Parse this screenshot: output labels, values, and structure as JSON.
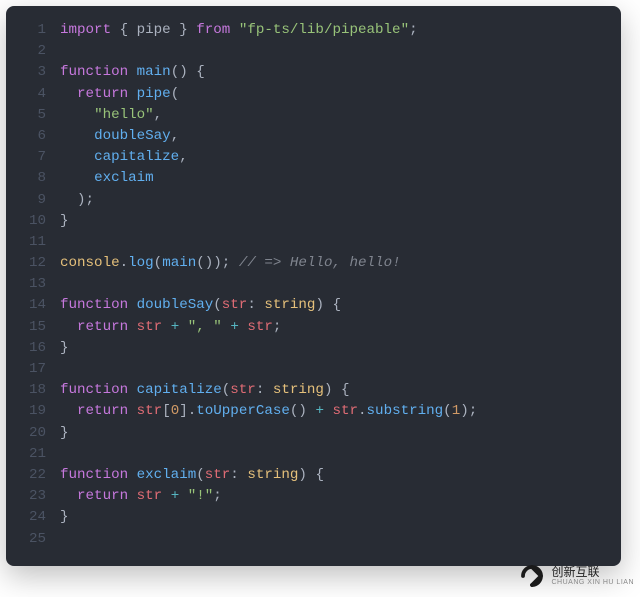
{
  "lines": [
    {
      "n": "1",
      "tokens": [
        [
          "import ",
          "kw"
        ],
        [
          "{ pipe } ",
          "ptn"
        ],
        [
          "from ",
          "kw"
        ],
        [
          "\"fp-ts/lib/pipeable\"",
          "str"
        ],
        [
          ";",
          "ptn"
        ]
      ]
    },
    {
      "n": "2",
      "tokens": []
    },
    {
      "n": "3",
      "tokens": [
        [
          "function ",
          "kw"
        ],
        [
          "main",
          "fn"
        ],
        [
          "() {",
          "ptn"
        ]
      ]
    },
    {
      "n": "4",
      "tokens": [
        [
          "  ",
          "ptn"
        ],
        [
          "return ",
          "kw"
        ],
        [
          "pipe",
          "fn"
        ],
        [
          "(",
          "ptn"
        ]
      ]
    },
    {
      "n": "5",
      "tokens": [
        [
          "    ",
          "ptn"
        ],
        [
          "\"hello\"",
          "str"
        ],
        [
          ",",
          "ptn"
        ]
      ]
    },
    {
      "n": "6",
      "tokens": [
        [
          "    ",
          "ptn"
        ],
        [
          "doubleSay",
          "fn"
        ],
        [
          ",",
          "ptn"
        ]
      ]
    },
    {
      "n": "7",
      "tokens": [
        [
          "    ",
          "ptn"
        ],
        [
          "capitalize",
          "fn"
        ],
        [
          ",",
          "ptn"
        ]
      ]
    },
    {
      "n": "8",
      "tokens": [
        [
          "    ",
          "ptn"
        ],
        [
          "exclaim",
          "fn"
        ]
      ]
    },
    {
      "n": "9",
      "tokens": [
        [
          "  );",
          "ptn"
        ]
      ]
    },
    {
      "n": "10",
      "tokens": [
        [
          "}",
          "ptn"
        ]
      ]
    },
    {
      "n": "11",
      "tokens": []
    },
    {
      "n": "12",
      "tokens": [
        [
          "console",
          "cons"
        ],
        [
          ".",
          "ptn"
        ],
        [
          "log",
          "fn"
        ],
        [
          "(",
          "ptn"
        ],
        [
          "main",
          "fn"
        ],
        [
          "()); ",
          "ptn"
        ],
        [
          "// => Hello, hello!",
          "cmt"
        ]
      ]
    },
    {
      "n": "13",
      "tokens": []
    },
    {
      "n": "14",
      "tokens": [
        [
          "function ",
          "kw"
        ],
        [
          "doubleSay",
          "fn"
        ],
        [
          "(",
          "ptn"
        ],
        [
          "str",
          "id"
        ],
        [
          ": ",
          "ptn"
        ],
        [
          "string",
          "prm"
        ],
        [
          ") {",
          "ptn"
        ]
      ]
    },
    {
      "n": "15",
      "tokens": [
        [
          "  ",
          "ptn"
        ],
        [
          "return ",
          "kw"
        ],
        [
          "str",
          "id"
        ],
        [
          " ",
          "ptn"
        ],
        [
          "+",
          "op"
        ],
        [
          " ",
          "ptn"
        ],
        [
          "\", \"",
          "str"
        ],
        [
          " ",
          "ptn"
        ],
        [
          "+",
          "op"
        ],
        [
          " ",
          "ptn"
        ],
        [
          "str",
          "id"
        ],
        [
          ";",
          "ptn"
        ]
      ]
    },
    {
      "n": "16",
      "tokens": [
        [
          "}",
          "ptn"
        ]
      ]
    },
    {
      "n": "17",
      "tokens": []
    },
    {
      "n": "18",
      "tokens": [
        [
          "function ",
          "kw"
        ],
        [
          "capitalize",
          "fn"
        ],
        [
          "(",
          "ptn"
        ],
        [
          "str",
          "id"
        ],
        [
          ": ",
          "ptn"
        ],
        [
          "string",
          "prm"
        ],
        [
          ") {",
          "ptn"
        ]
      ]
    },
    {
      "n": "19",
      "tokens": [
        [
          "  ",
          "ptn"
        ],
        [
          "return ",
          "kw"
        ],
        [
          "str",
          "id"
        ],
        [
          "[",
          "ptn"
        ],
        [
          "0",
          "num"
        ],
        [
          "].",
          "ptn"
        ],
        [
          "toUpperCase",
          "fn"
        ],
        [
          "() ",
          "ptn"
        ],
        [
          "+",
          "op"
        ],
        [
          " ",
          "ptn"
        ],
        [
          "str",
          "id"
        ],
        [
          ".",
          "ptn"
        ],
        [
          "substring",
          "fn"
        ],
        [
          "(",
          "ptn"
        ],
        [
          "1",
          "num"
        ],
        [
          ");",
          "ptn"
        ]
      ]
    },
    {
      "n": "20",
      "tokens": [
        [
          "}",
          "ptn"
        ]
      ]
    },
    {
      "n": "21",
      "tokens": []
    },
    {
      "n": "22",
      "tokens": [
        [
          "function ",
          "kw"
        ],
        [
          "exclaim",
          "fn"
        ],
        [
          "(",
          "ptn"
        ],
        [
          "str",
          "id"
        ],
        [
          ": ",
          "ptn"
        ],
        [
          "string",
          "prm"
        ],
        [
          ") {",
          "ptn"
        ]
      ]
    },
    {
      "n": "23",
      "tokens": [
        [
          "  ",
          "ptn"
        ],
        [
          "return ",
          "kw"
        ],
        [
          "str",
          "id"
        ],
        [
          " ",
          "ptn"
        ],
        [
          "+",
          "op"
        ],
        [
          " ",
          "ptn"
        ],
        [
          "\"!\"",
          "str"
        ],
        [
          ";",
          "ptn"
        ]
      ]
    },
    {
      "n": "24",
      "tokens": [
        [
          "}",
          "ptn"
        ]
      ]
    },
    {
      "n": "25",
      "tokens": []
    }
  ],
  "watermark": {
    "title": "创新互联",
    "subtitle": "CHUANG XIN HU LIAN"
  }
}
